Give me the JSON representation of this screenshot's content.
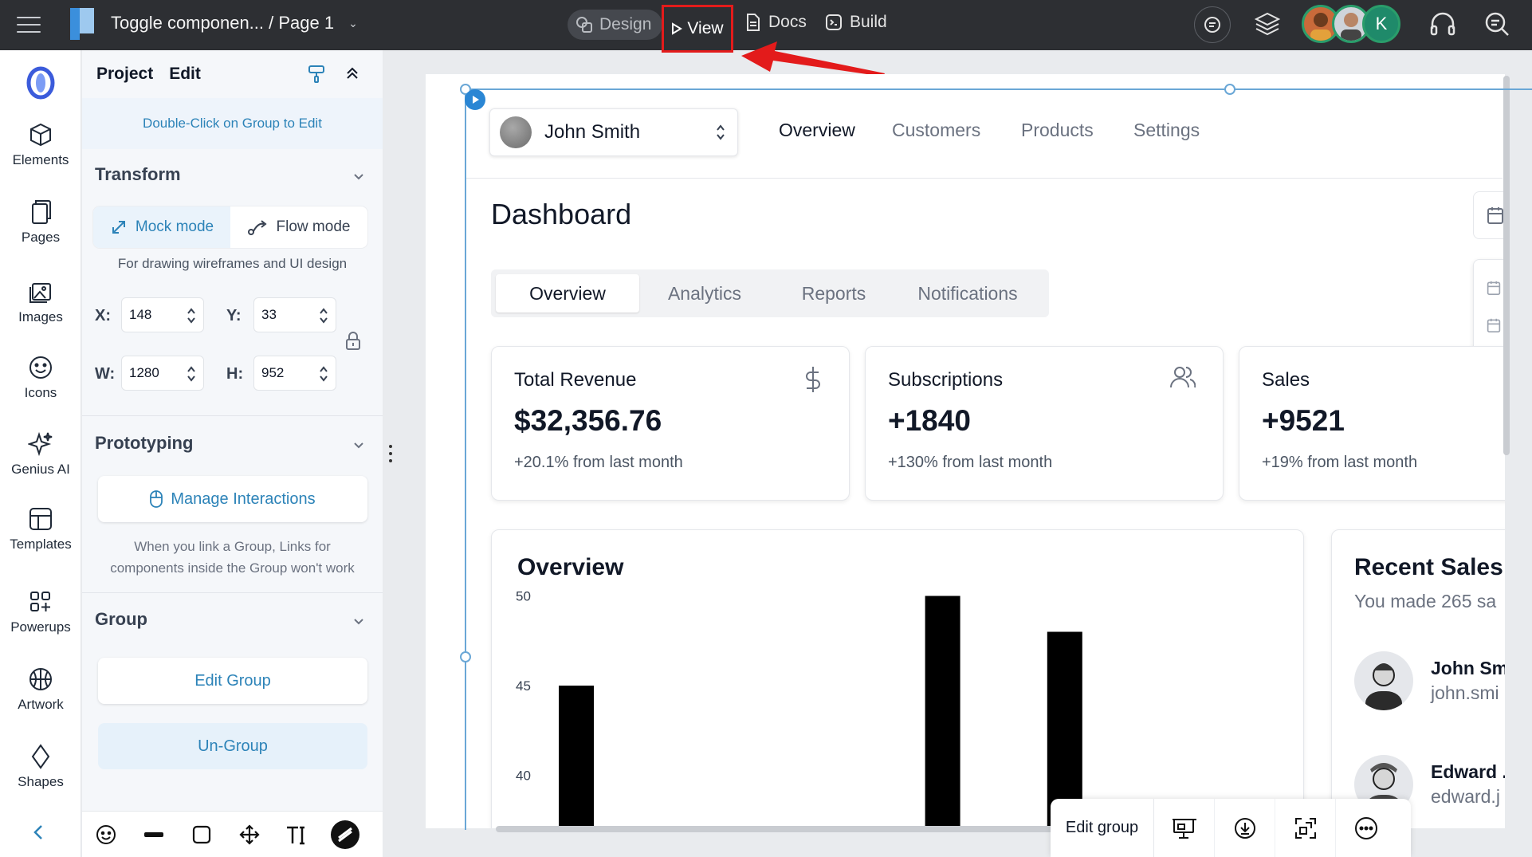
{
  "topbar": {
    "doc_title": "Toggle componen... / Page 1",
    "modes": {
      "design": "Design",
      "view": "View",
      "docs": "Docs",
      "build": "Build"
    },
    "avatar_initial": "K"
  },
  "rail": {
    "items": [
      {
        "label": "Elements"
      },
      {
        "label": "Pages"
      },
      {
        "label": "Images"
      },
      {
        "label": "Icons"
      },
      {
        "label": "Genius AI"
      },
      {
        "label": "Templates"
      },
      {
        "label": "Powerups"
      },
      {
        "label": "Artwork"
      },
      {
        "label": "Shapes"
      }
    ]
  },
  "panel": {
    "tab_project": "Project",
    "tab_edit": "Edit",
    "hint": "Double-Click on Group to Edit",
    "transform": {
      "title": "Transform",
      "mock_mode": "Mock mode",
      "flow_mode": "Flow mode",
      "caption": "For drawing wireframes and UI design",
      "x_label": "X:",
      "x_value": "148",
      "y_label": "Y:",
      "y_value": "33",
      "w_label": "W:",
      "w_value": "1280",
      "h_label": "H:",
      "h_value": "952"
    },
    "prototyping": {
      "title": "Prototyping",
      "manage": "Manage Interactions",
      "caption_1": "When you link a Group, Links for",
      "caption_2": "components inside the Group won't work"
    },
    "group": {
      "title": "Group",
      "edit": "Edit Group",
      "ungroup": "Un-Group"
    }
  },
  "artboard": {
    "user_name": "John Smith",
    "nav": [
      "Overview",
      "Customers",
      "Products",
      "Settings"
    ],
    "page_title": "Dashboard",
    "tabs": [
      "Overview",
      "Analytics",
      "Reports",
      "Notifications"
    ],
    "cards": [
      {
        "title": "Total Revenue",
        "value": "$32,356.76",
        "sub": "+20.1% from last month",
        "icon": "dollar-icon"
      },
      {
        "title": "Subscriptions",
        "value": "+1840",
        "sub": "+130% from last month",
        "icon": "users-icon"
      },
      {
        "title": "Sales",
        "value": "+9521",
        "sub": "+19% from last month",
        "icon": ""
      }
    ],
    "recent_sales": {
      "title": "Recent Sales",
      "subtitle": "You made 265 sa",
      "people": [
        {
          "name": "John Sm",
          "email": "john.smi"
        },
        {
          "name": "Edward .",
          "email": "edward.j"
        }
      ]
    }
  },
  "chart_data": {
    "type": "bar",
    "title": "Overview",
    "ylabel": "",
    "xlabel": "",
    "yticks": [
      "50",
      "45",
      "40"
    ],
    "ylim": [
      35,
      51
    ],
    "values": [
      45,
      null,
      null,
      null,
      null,
      null,
      50,
      null,
      48
    ],
    "grid": false,
    "bar_color": "#000000"
  },
  "float_toolbar": {
    "edit_group": "Edit group"
  },
  "colors": {
    "accent": "#2c83b8",
    "topbar": "#2d2f33",
    "highlight": "#e31b1b",
    "selection": "#6aa7d6"
  }
}
